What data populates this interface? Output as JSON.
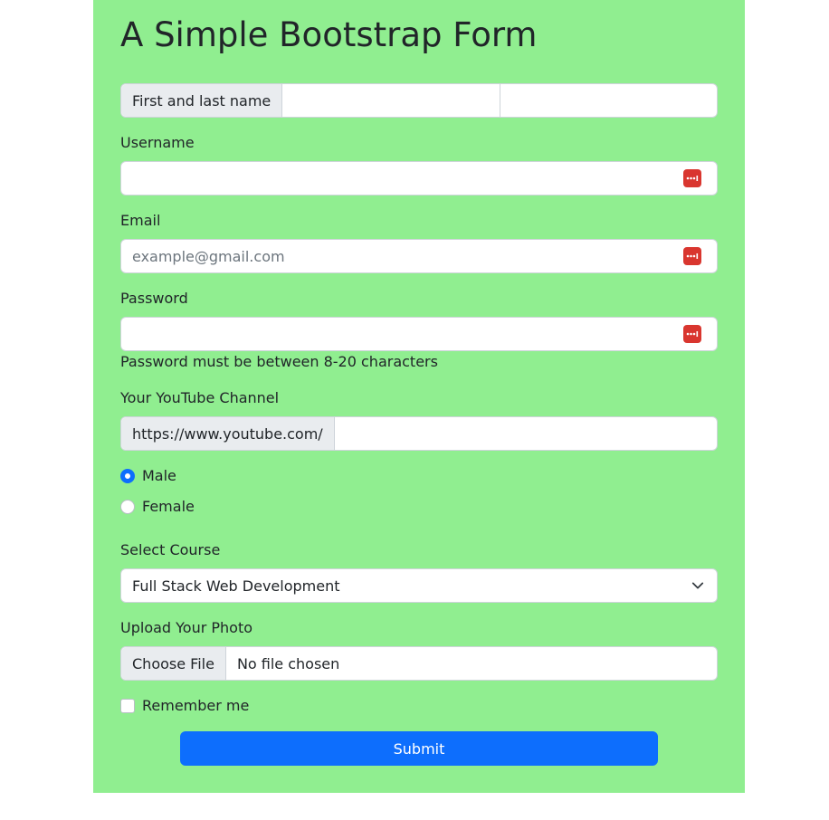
{
  "page": {
    "title": "A Simple Bootstrap Form"
  },
  "colors": {
    "panel_bg": "#90ee90",
    "submit_bg": "#0d6efd",
    "password_icon_bg": "#d9362f"
  },
  "name_group": {
    "addon": "First and last name",
    "first_value": "",
    "last_value": ""
  },
  "username": {
    "label": "Username",
    "value": "",
    "icon": "password-manager-icon"
  },
  "email": {
    "label": "Email",
    "placeholder": "example@gmail.com",
    "value": "",
    "icon": "password-manager-icon"
  },
  "password": {
    "label": "Password",
    "value": "",
    "help": "Password must be between 8-20 characters",
    "icon": "password-manager-icon"
  },
  "youtube": {
    "label": "Your YouTube Channel",
    "addon": "https://www.youtube.com/",
    "value": ""
  },
  "gender": {
    "options": [
      {
        "label": "Male",
        "checked": true
      },
      {
        "label": "Female",
        "checked": false
      }
    ]
  },
  "course": {
    "label": "Select Course",
    "selected": "Full Stack Web Development",
    "icon": "chevron-down-icon"
  },
  "photo": {
    "label": "Upload Your Photo",
    "button": "Choose File",
    "status": "No file chosen"
  },
  "remember": {
    "label": "Remember me",
    "checked": false
  },
  "submit": {
    "label": "Submit"
  }
}
